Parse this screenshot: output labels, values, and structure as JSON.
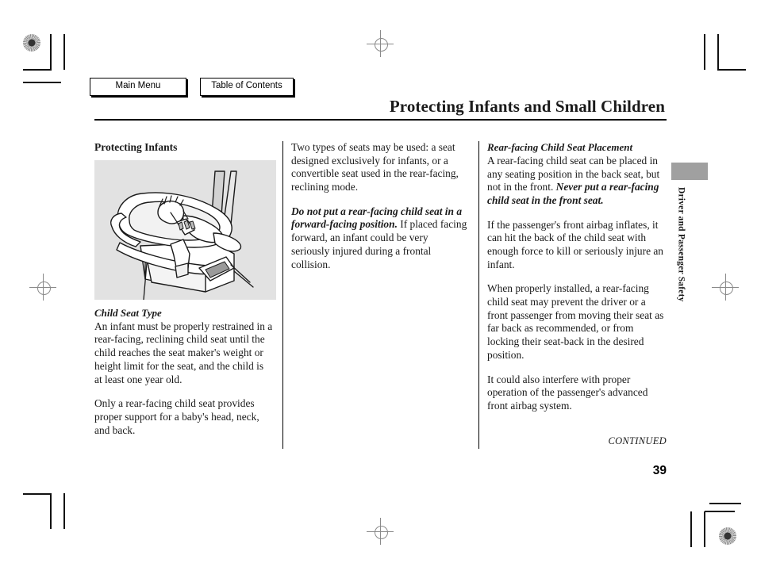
{
  "nav": {
    "main_menu": "Main Menu",
    "table_of_contents": "Table of Contents"
  },
  "header": {
    "title": "Protecting Infants and Small Children"
  },
  "column1": {
    "section_title": "Protecting Infants",
    "figure_caption_alt": "rear-facing infant child seat secured by seat belt",
    "sub_title": "Child Seat Type",
    "paragraph1": "An infant must be properly restrained in a rear-facing, reclining child seat until the child reaches the seat maker's weight or height limit for the seat, and the child is at least one year old.",
    "paragraph2": "Only a rear-facing child seat provides proper support for a baby's head, neck, and back."
  },
  "column2": {
    "paragraph1": "Two types of seats may be used: a seat designed exclusively for infants, or a convertible seat used in the rear-facing, reclining mode.",
    "paragraph2_bold": "Do not put a rear-facing child seat in a forward-facing position.",
    "paragraph2_rest": " If placed facing forward, an infant could be very seriously injured during a frontal collision."
  },
  "column3": {
    "sub_title": "Rear-facing Child Seat Placement",
    "paragraph1_plain": "A rear-facing child seat can be placed in any seating position in the back seat, but not in the front. ",
    "paragraph1_bold": "Never put a rear-facing child seat in the front seat.",
    "paragraph2": "If the passenger's front airbag inflates, it can hit the back of the child seat with enough force to kill or seriously injure an infant.",
    "paragraph3": "When properly installed, a rear-facing child seat may prevent the driver or a front passenger from moving their seat as far back as recommended, or from locking their seat-back in the desired position.",
    "paragraph4": "It could also interfere with proper operation of the passenger's advanced front airbag system."
  },
  "side_tab": {
    "label": "Driver and Passenger Safety"
  },
  "footer": {
    "continued": "CONTINUED",
    "page_number": "39"
  },
  "colors": {
    "figure_background": "#e2e2e2",
    "side_tab_block": "#a0a0a0",
    "rule": "#000000",
    "text": "#1a1a1a"
  }
}
